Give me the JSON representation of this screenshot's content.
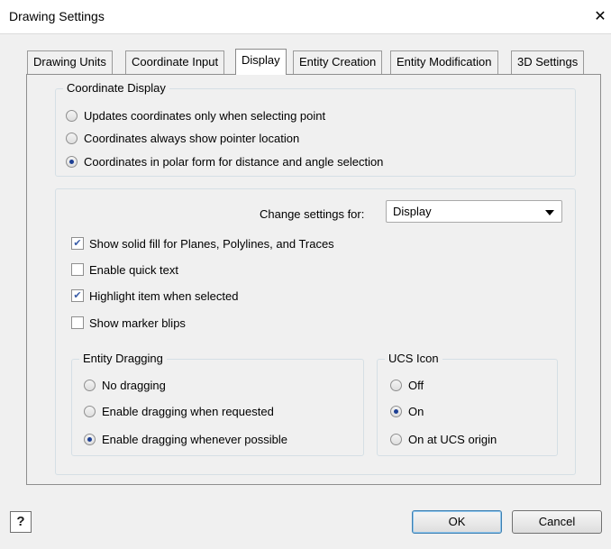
{
  "window": {
    "title": "Drawing Settings",
    "close_glyph": "✕"
  },
  "tabs": [
    {
      "label": "Drawing Units",
      "active": false
    },
    {
      "label": "Coordinate Input",
      "active": false
    },
    {
      "label": "Display",
      "active": true
    },
    {
      "label": "Entity Creation",
      "active": false
    },
    {
      "label": "Entity Modification",
      "active": false
    },
    {
      "label": "3D Settings",
      "active": false
    }
  ],
  "coordinate_display": {
    "legend": "Coordinate Display",
    "options": [
      {
        "label": "Updates coordinates only when selecting point",
        "selected": false
      },
      {
        "label": "Coordinates always show pointer location",
        "selected": false
      },
      {
        "label": "Coordinates in polar form for distance and angle selection",
        "selected": true
      }
    ]
  },
  "settings": {
    "change_label": "Change settings for:",
    "change_value": "Display",
    "checkboxes": [
      {
        "label": "Show solid fill for Planes, Polylines, and Traces",
        "checked": true
      },
      {
        "label": "Enable quick text",
        "checked": false
      },
      {
        "label": "Highlight item when selected",
        "checked": true
      },
      {
        "label": "Show marker blips",
        "checked": false
      }
    ]
  },
  "entity_dragging": {
    "legend": "Entity Dragging",
    "options": [
      {
        "label": "No dragging",
        "selected": false
      },
      {
        "label": "Enable dragging when requested",
        "selected": false
      },
      {
        "label": "Enable dragging whenever possible",
        "selected": true
      }
    ]
  },
  "ucs_icon": {
    "legend": "UCS Icon",
    "options": [
      {
        "label": "Off",
        "selected": false
      },
      {
        "label": "On",
        "selected": true
      },
      {
        "label": "On at UCS origin",
        "selected": false
      }
    ]
  },
  "footer": {
    "help_label": "?",
    "ok_label": "OK",
    "cancel_label": "Cancel"
  },
  "colors": {
    "radio_dot": "#1c3f94",
    "check_mark": "#3a5da8",
    "default_button_border": "#3c7fb1"
  }
}
